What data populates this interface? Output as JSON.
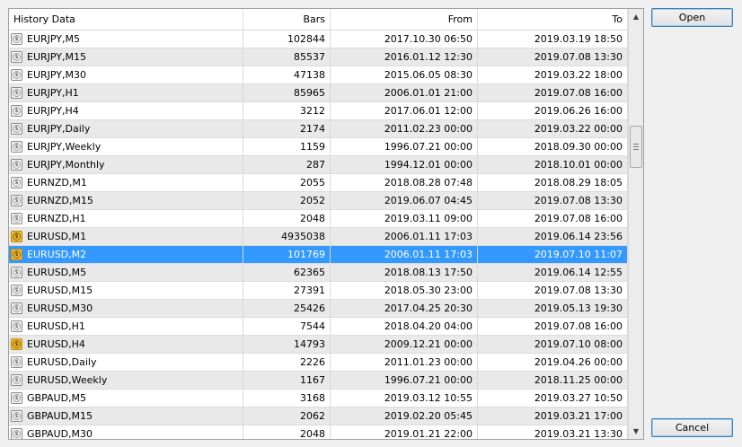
{
  "columns": [
    "History Data",
    "Bars",
    "From",
    "To"
  ],
  "rows": [
    {
      "symbol": "EURJPY,M5",
      "bars": "102844",
      "from": "2017.10.30 06:50",
      "to": "2019.03.19 18:50",
      "icon": "coin-icon"
    },
    {
      "symbol": "EURJPY,M15",
      "bars": "85537",
      "from": "2016.01.12 12:30",
      "to": "2019.07.08 13:30",
      "icon": "coin-icon"
    },
    {
      "symbol": "EURJPY,M30",
      "bars": "47138",
      "from": "2015.06.05 08:30",
      "to": "2019.03.22 18:00",
      "icon": "coin-icon"
    },
    {
      "symbol": "EURJPY,H1",
      "bars": "85965",
      "from": "2006.01.01 21:00",
      "to": "2019.07.08 16:00",
      "icon": "coin-icon"
    },
    {
      "symbol": "EURJPY,H4",
      "bars": "3212",
      "from": "2017.06.01 12:00",
      "to": "2019.06.26 16:00",
      "icon": "coin-icon"
    },
    {
      "symbol": "EURJPY,Daily",
      "bars": "2174",
      "from": "2011.02.23 00:00",
      "to": "2019.03.22 00:00",
      "icon": "coin-icon"
    },
    {
      "symbol": "EURJPY,Weekly",
      "bars": "1159",
      "from": "1996.07.21 00:00",
      "to": "2018.09.30 00:00",
      "icon": "coin-icon"
    },
    {
      "symbol": "EURJPY,Monthly",
      "bars": "287",
      "from": "1994.12.01 00:00",
      "to": "2018.10.01 00:00",
      "icon": "coin-icon"
    },
    {
      "symbol": "EURNZD,M1",
      "bars": "2055",
      "from": "2018.08.28 07:48",
      "to": "2018.08.29 18:05",
      "icon": "coin-icon"
    },
    {
      "symbol": "EURNZD,M15",
      "bars": "2052",
      "from": "2019.06.07 04:45",
      "to": "2019.07.08 13:30",
      "icon": "coin-icon"
    },
    {
      "symbol": "EURNZD,H1",
      "bars": "2048",
      "from": "2019.03.11 09:00",
      "to": "2019.07.08 16:00",
      "icon": "coin-icon"
    },
    {
      "symbol": "EURUSD,M1",
      "bars": "4935038",
      "from": "2006.01.11 17:03",
      "to": "2019.06.14 23:56",
      "icon": "coin-gold-icon"
    },
    {
      "symbol": "EURUSD,M2",
      "bars": "101769",
      "from": "2006.01.11 17:03",
      "to": "2019.07.10 11:07",
      "icon": "coin-gold-icon"
    },
    {
      "symbol": "EURUSD,M5",
      "bars": "62365",
      "from": "2018.08.13 17:50",
      "to": "2019.06.14 12:55",
      "icon": "coin-icon"
    },
    {
      "symbol": "EURUSD,M15",
      "bars": "27391",
      "from": "2018.05.30 23:00",
      "to": "2019.07.08 13:30",
      "icon": "coin-icon"
    },
    {
      "symbol": "EURUSD,M30",
      "bars": "25426",
      "from": "2017.04.25 20:30",
      "to": "2019.05.13 19:30",
      "icon": "coin-icon"
    },
    {
      "symbol": "EURUSD,H1",
      "bars": "7544",
      "from": "2018.04.20 04:00",
      "to": "2019.07.08 16:00",
      "icon": "coin-icon"
    },
    {
      "symbol": "EURUSD,H4",
      "bars": "14793",
      "from": "2009.12.21 00:00",
      "to": "2019.07.10 08:00",
      "icon": "coin-gold-icon"
    },
    {
      "symbol": "EURUSD,Daily",
      "bars": "2226",
      "from": "2011.01.23 00:00",
      "to": "2019.04.26 00:00",
      "icon": "coin-icon"
    },
    {
      "symbol": "EURUSD,Weekly",
      "bars": "1167",
      "from": "1996.07.21 00:00",
      "to": "2018.11.25 00:00",
      "icon": "coin-icon"
    },
    {
      "symbol": "GBPAUD,M5",
      "bars": "3168",
      "from": "2019.03.12 10:55",
      "to": "2019.03.27 10:50",
      "icon": "coin-icon"
    },
    {
      "symbol": "GBPAUD,M15",
      "bars": "2062",
      "from": "2019.02.20 05:45",
      "to": "2019.03.21 17:00",
      "icon": "coin-icon"
    },
    {
      "symbol": "GBPAUD,M30",
      "bars": "2048",
      "from": "2019.01.21 22:00",
      "to": "2019.03.21 13:30",
      "icon": "coin-icon"
    }
  ],
  "selected_row": 12,
  "buttons": {
    "open": "Open",
    "cancel": "Cancel"
  },
  "colors": {
    "selection": "#3399ff",
    "alt_row": "#e9e9e9",
    "gold_icon": "#f1c13a"
  }
}
